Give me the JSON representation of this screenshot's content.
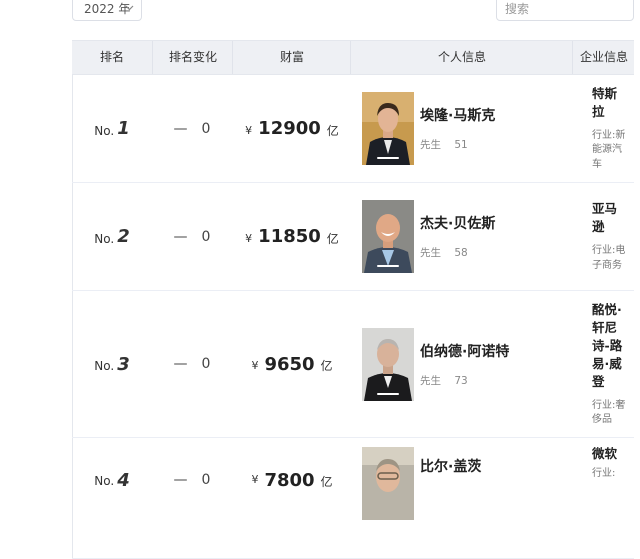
{
  "filters": {
    "year_label": "2022 年",
    "search_placeholder": "搜索"
  },
  "table": {
    "headers": [
      "排名",
      "排名变化",
      "财富",
      "个人信息",
      "企业信息"
    ],
    "rank_prefix": "No.",
    "currency_symbol": "¥",
    "wealth_unit": "亿",
    "change_symbol": "—",
    "industry_prefix": "行业:",
    "rows": [
      {
        "rank": "1",
        "change": "0",
        "wealth": "12900",
        "name": "埃隆·马斯克",
        "title": "先生",
        "age": "51",
        "company": "特斯拉",
        "industry": "新能源汽车"
      },
      {
        "rank": "2",
        "change": "0",
        "wealth": "11850",
        "name": "杰夫·贝佐斯",
        "title": "先生",
        "age": "58",
        "company": "亚马逊",
        "industry": "电子商务"
      },
      {
        "rank": "3",
        "change": "0",
        "wealth": "9650",
        "name": "伯纳德·阿诺特",
        "title": "先生",
        "age": "73",
        "company": "酩悦·轩尼诗-路易·威登",
        "industry": "奢侈品"
      },
      {
        "rank": "4",
        "change": "0",
        "wealth": "7800",
        "name": "比尔·盖茨",
        "title": "",
        "age": "",
        "company": "微软",
        "industry": ""
      }
    ]
  },
  "colors": {
    "header_bg": "#eef0f4",
    "border": "#ebeef5"
  },
  "icons": {
    "select": "chevron-down-icon"
  }
}
